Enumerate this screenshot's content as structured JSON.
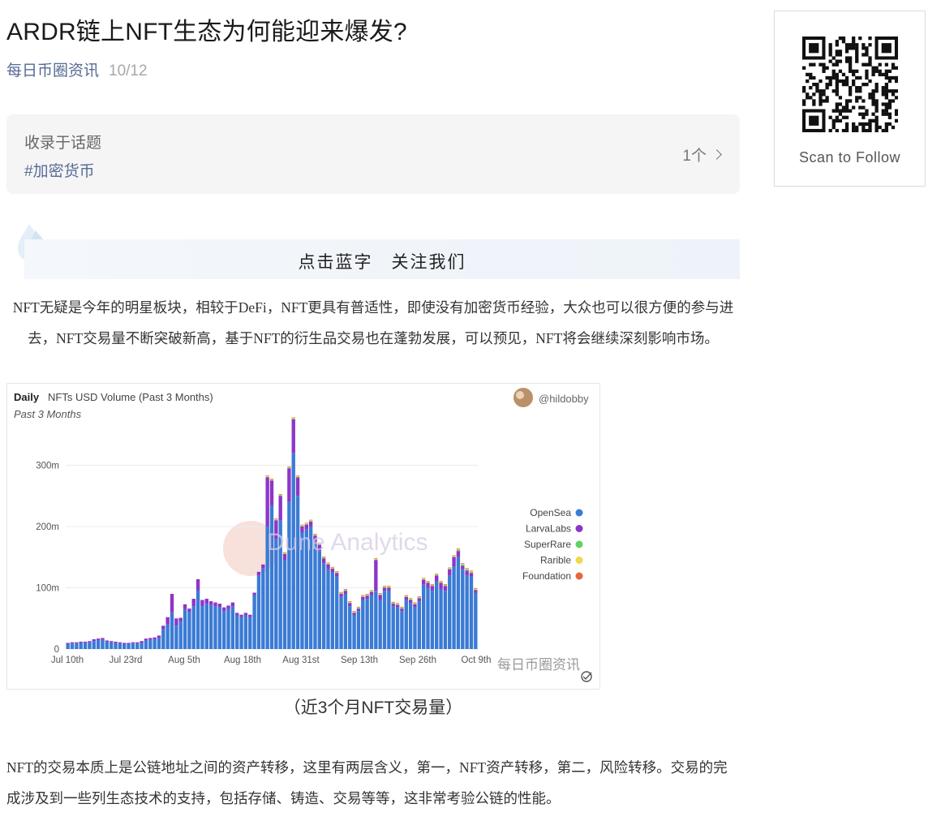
{
  "article": {
    "title": "ARDR链上NFT生态为何能迎来爆发?",
    "account": "每日币圈资讯",
    "date": "10/12",
    "topic": {
      "label": "收录于话题",
      "tag": "#加密货币",
      "count": "1个"
    },
    "follow_banner": "点击蓝字　关注我们",
    "paragraph1": "NFT无疑是今年的明星板块，相较于DeFi，NFT更具有普适性，即使没有加密货币经验，大众也可以很方便的参与进去，NFT交易量不断突破新高，基于NFT的衍生品交易也在蓬勃发展，可以预见，NFT将会继续深刻影响市场。",
    "caption": "（近3个月NFT交易量）",
    "paragraph2": "NFT的交易本质上是公链地址之间的资产转移，这里有两层含义，第一，NFT资产转移，第二，风险转移。交易的完成涉及到一些列生态技术的支持，包括存储、铸造、交易等等，这非常考验公链的性能。"
  },
  "qr_panel": {
    "label": "Scan to Follow"
  },
  "chart_data": {
    "type": "bar",
    "period": "Daily",
    "title": "NFTs USD Volume (Past 3 Months)",
    "subtitle": "Past 3 Months",
    "author": "@hildobby",
    "watermark": "Dune Analytics",
    "overlay_watermark": "每日币圈资讯",
    "stacked": true,
    "x_tick_labels": [
      "Jul 10th",
      "Jul 23rd",
      "Aug 5th",
      "Aug 18th",
      "Aug 31st",
      "Sep 13th",
      "Sep 26th",
      "Oct 9th"
    ],
    "y_tick_labels": [
      "0",
      "100m",
      "200m",
      "300m"
    ],
    "ylim": [
      0,
      380
    ],
    "y_unit": "m",
    "grid": true,
    "legend_position": "right",
    "series": [
      {
        "name": "OpenSea",
        "color": "#3a7bd5",
        "values": [
          8,
          9,
          9,
          10,
          10,
          11,
          13,
          14,
          15,
          12,
          11,
          10,
          9,
          8,
          8,
          9,
          9,
          10,
          14,
          15,
          16,
          18,
          32,
          40,
          60,
          38,
          45,
          65,
          60,
          70,
          96,
          70,
          74,
          72,
          70,
          68,
          62,
          65,
          70,
          55,
          52,
          55,
          52,
          88,
          120,
          132,
          200,
          235,
          180,
          210,
          145,
          240,
          320,
          250,
          190,
          195,
          200,
          175,
          160,
          140,
          130,
          125,
          118,
          85,
          90,
          70,
          55,
          62,
          80,
          82,
          88,
          95,
          80,
          95,
          96,
          70,
          68,
          62,
          80,
          75,
          68,
          78,
          105,
          100,
          95,
          110,
          98,
          95,
          120,
          135,
          150,
          130,
          120,
          118,
          92
        ]
      },
      {
        "name": "LarvaLabs",
        "color": "#8e35c9",
        "values": [
          2,
          2,
          2,
          2,
          2,
          2,
          3,
          3,
          3,
          2,
          2,
          2,
          2,
          2,
          2,
          2,
          2,
          3,
          3,
          3,
          3,
          4,
          6,
          12,
          30,
          12,
          6,
          8,
          6,
          12,
          18,
          10,
          8,
          6,
          6,
          6,
          6,
          6,
          6,
          4,
          4,
          4,
          4,
          4,
          6,
          6,
          80,
          40,
          30,
          40,
          10,
          55,
          55,
          30,
          10,
          8,
          8,
          10,
          10,
          8,
          8,
          6,
          6,
          5,
          5,
          5,
          4,
          4,
          5,
          5,
          5,
          50,
          8,
          5,
          4,
          4,
          4,
          4,
          5,
          5,
          5,
          5,
          8,
          8,
          8,
          10,
          10,
          8,
          10,
          15,
          10,
          6,
          8,
          6,
          4
        ]
      },
      {
        "name": "SuperRare",
        "color": "#5fd35f",
        "values": [
          0,
          0,
          0,
          0,
          0,
          0,
          0,
          0,
          0,
          0,
          0,
          0,
          0,
          0,
          0,
          0,
          0,
          0,
          0,
          0,
          0,
          0,
          0,
          0,
          0,
          0,
          0,
          0,
          0,
          0,
          0,
          0,
          0,
          0,
          0,
          0,
          0,
          0,
          0,
          0,
          0,
          0,
          0,
          0,
          0,
          0,
          1,
          1,
          1,
          1,
          1,
          1,
          1,
          1,
          1,
          1,
          1,
          1,
          1,
          1,
          1,
          1,
          1,
          1,
          1,
          1,
          1,
          1,
          1,
          1,
          1,
          1,
          1,
          1,
          1,
          1,
          1,
          1,
          1,
          1,
          1,
          1,
          1,
          1,
          1,
          1,
          1,
          1,
          1,
          1,
          2,
          2,
          2,
          2,
          1
        ]
      },
      {
        "name": "Rarible",
        "color": "#f0d84a",
        "values": [
          0,
          0,
          0,
          0,
          0,
          0,
          0,
          0,
          0,
          0,
          0,
          0,
          0,
          0,
          0,
          0,
          0,
          0,
          0,
          0,
          0,
          0,
          0,
          0,
          0,
          0,
          0,
          0,
          0,
          0,
          0,
          0,
          0,
          0,
          0,
          0,
          0,
          0,
          0,
          0,
          0,
          0,
          0,
          0,
          0,
          0,
          1,
          1,
          1,
          1,
          1,
          1,
          1,
          1,
          1,
          1,
          1,
          1,
          1,
          1,
          1,
          1,
          1,
          1,
          1,
          1,
          1,
          1,
          1,
          1,
          1,
          1,
          1,
          1,
          1,
          1,
          1,
          1,
          1,
          1,
          1,
          1,
          1,
          1,
          1,
          1,
          1,
          1,
          1,
          1,
          1,
          1,
          1,
          1,
          1
        ]
      },
      {
        "name": "Foundation",
        "color": "#e8663c",
        "values": [
          0,
          0,
          0,
          0,
          0,
          0,
          0,
          0,
          0,
          0,
          0,
          0,
          0,
          0,
          0,
          0,
          0,
          0,
          0,
          0,
          0,
          0,
          0,
          0,
          0,
          0,
          0,
          0,
          0,
          0,
          0,
          0,
          0,
          0,
          0,
          0,
          0,
          0,
          0,
          0,
          0,
          0,
          0,
          0,
          0,
          0,
          1,
          1,
          1,
          1,
          1,
          1,
          1,
          1,
          1,
          1,
          1,
          1,
          1,
          1,
          1,
          1,
          1,
          1,
          1,
          1,
          1,
          1,
          1,
          1,
          1,
          1,
          1,
          1,
          1,
          1,
          1,
          1,
          1,
          1,
          1,
          1,
          1,
          1,
          1,
          1,
          1,
          1,
          1,
          1,
          1,
          1,
          1,
          1,
          1
        ]
      }
    ]
  }
}
